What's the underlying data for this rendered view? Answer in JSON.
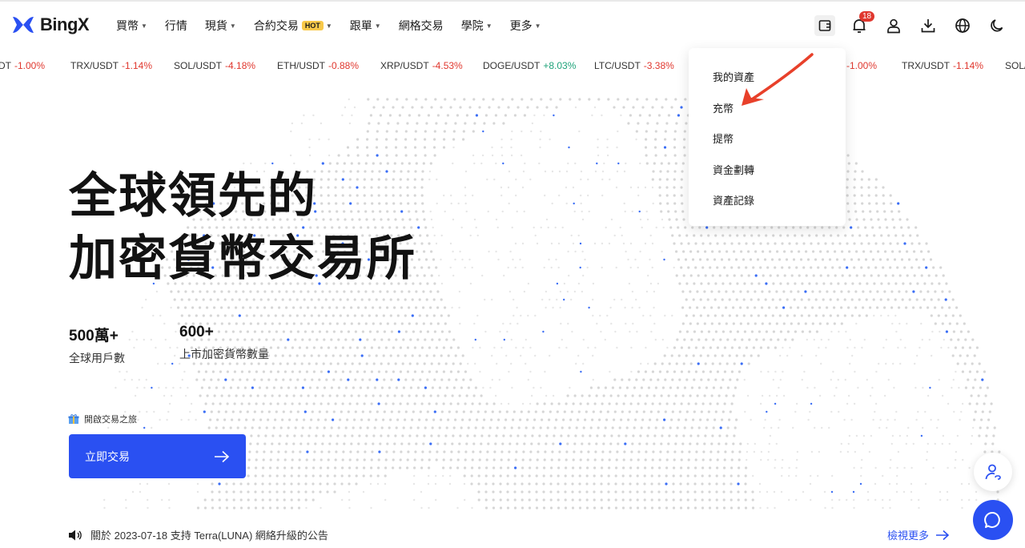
{
  "brand": {
    "name": "BingX"
  },
  "nav": [
    {
      "label": "買幣",
      "caret": true
    },
    {
      "label": "行情",
      "caret": false
    },
    {
      "label": "現貨",
      "caret": true
    },
    {
      "label": "合約交易",
      "caret": true,
      "badge": "HOT"
    },
    {
      "label": "跟單",
      "caret": true
    },
    {
      "label": "網格交易",
      "caret": false
    },
    {
      "label": "學院",
      "caret": true
    },
    {
      "label": "更多",
      "caret": true
    }
  ],
  "header_icons": {
    "wallet": "wallet-icon",
    "notifications": {
      "icon": "bell-icon",
      "count": "18"
    },
    "user": "user-icon",
    "download": "download-icon",
    "language": "globe-icon",
    "theme": "moon-icon"
  },
  "ticker": [
    {
      "pair": "DT",
      "change": "-1.00%",
      "dir": "neg"
    },
    {
      "pair": "TRX/USDT",
      "change": "-1.14%",
      "dir": "neg"
    },
    {
      "pair": "SOL/USDT",
      "change": "-4.18%",
      "dir": "neg"
    },
    {
      "pair": "ETH/USDT",
      "change": "-0.88%",
      "dir": "neg"
    },
    {
      "pair": "XRP/USDT",
      "change": "-4.53%",
      "dir": "neg"
    },
    {
      "pair": "DOGE/USDT",
      "change": "+8.03%",
      "dir": "pos"
    },
    {
      "pair": "LTC/USDT",
      "change": "-3.38%",
      "dir": "neg"
    },
    {
      "pair": "",
      "change": "-1.00%",
      "dir": "neg"
    },
    {
      "pair": "TRX/USDT",
      "change": "-1.14%",
      "dir": "neg"
    },
    {
      "pair": "SOL/",
      "change": "",
      "dir": "neg"
    }
  ],
  "hero": {
    "title_line1": "全球領先的",
    "title_line2": "加密貨幣交易所",
    "stats": [
      {
        "value": "500萬+",
        "label": "全球用戶數"
      },
      {
        "value": "600+",
        "label": "上市加密貨幣數量"
      }
    ],
    "journey_label": "開啟交易之旅",
    "cta_label": "立即交易"
  },
  "wallet_menu": {
    "items": [
      "我的資產",
      "充幣",
      "提幣",
      "資金劃轉",
      "資產記錄"
    ]
  },
  "announcement": {
    "text": "關於 2023-07-18 支持 Terra(LUNA) 網絡升級的公告",
    "more_label": "檢視更多"
  },
  "colors": {
    "accent": "#2a50f2",
    "negative": "#e0372e",
    "positive": "#1fa37a",
    "hot_badge": "#f8c94a",
    "annotation": "#e8402a"
  }
}
